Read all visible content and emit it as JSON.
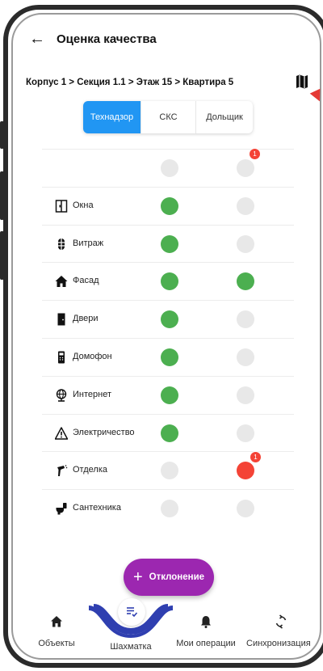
{
  "header": {
    "back_icon": "arrow-left-icon",
    "title": "Оценка качества"
  },
  "breadcrumb": "Корпус 1 > Секция 1.1 > Этаж 15 > Квартира 5",
  "map_icon": "map-icon",
  "tabs": [
    {
      "label": "Технадзор",
      "active": true
    },
    {
      "label": "СКС",
      "active": false
    },
    {
      "label": "Дольщик",
      "active": false
    }
  ],
  "rows": [
    {
      "label": "",
      "icon": "",
      "col1": "gray",
      "col2": "gray",
      "badge": "1"
    },
    {
      "label": "Окна",
      "icon": "window-icon",
      "col1": "green",
      "col2": "gray"
    },
    {
      "label": "Витраж",
      "icon": "stained-glass-icon",
      "col1": "green",
      "col2": "gray"
    },
    {
      "label": "Фасад",
      "icon": "house-icon",
      "col1": "green",
      "col2": "green"
    },
    {
      "label": "Двери",
      "icon": "door-icon",
      "col1": "green",
      "col2": "gray"
    },
    {
      "label": "Домофон",
      "icon": "intercom-icon",
      "col1": "green",
      "col2": "gray"
    },
    {
      "label": "Интернет",
      "icon": "globe-icon",
      "col1": "green",
      "col2": "gray"
    },
    {
      "label": "Электричество",
      "icon": "warning-icon",
      "col1": "green",
      "col2": "gray"
    },
    {
      "label": "Отделка",
      "icon": "spray-icon",
      "col1": "gray",
      "col2": "red",
      "badge": "1"
    },
    {
      "label": "Сантехника",
      "icon": "toilet-icon",
      "col1": "gray",
      "col2": "gray"
    }
  ],
  "fab": {
    "icon": "plus-icon",
    "label": "Отклонение"
  },
  "bottom_nav": [
    {
      "label": "Объекты",
      "icon": "home-icon"
    },
    {
      "label": "Шахматка",
      "icon": "list-check-icon",
      "active": true
    },
    {
      "label": "Мои операции",
      "icon": "bell-icon"
    },
    {
      "label": "Синхронизация",
      "icon": "sync-icon"
    }
  ],
  "colors": {
    "accent": "#2196f3",
    "fab": "#9c27b0",
    "green": "#4caf50",
    "red": "#f44336",
    "gray": "#e8e8e8",
    "nav_curve": "#2f3fb0"
  }
}
